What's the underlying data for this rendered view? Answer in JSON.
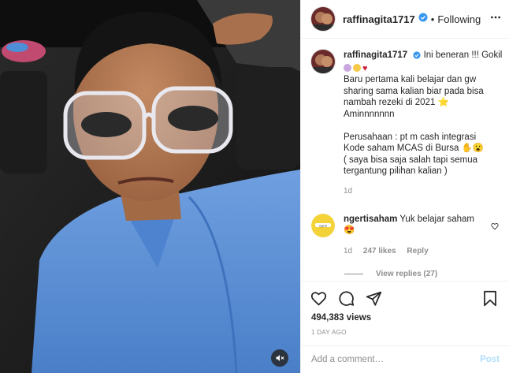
{
  "post": {
    "username": "raffinagita1717",
    "dot": "•",
    "follow_state": "Following"
  },
  "caption": {
    "username": "raffinagita1717",
    "first_line": "Ini beneran !!! Gokil",
    "lines": [
      "Baru pertama kali belajar dan gw",
      "sharing sama kalian biar pada bisa",
      "nambah rezeki di 2021 ⭐",
      "Aminnnnnnn"
    ],
    "lines2": [
      "Perusahaan : pt m cash integrasi",
      "Kode saham MCAS di Bursa ✋😮",
      "( saya bisa saja salah tapi semua",
      "tergantung pilihan kalian )"
    ],
    "time": "1d"
  },
  "comment": {
    "username": "ngertisaham",
    "text": "Yuk belajar saham",
    "emoji_line": "😍",
    "time": "1d",
    "likes": "247 likes",
    "reply_label": "Reply",
    "view_replies": "View replies (27)"
  },
  "stats": {
    "views": "494,383 views",
    "time_ago": "1 DAY AGO"
  },
  "add_comment": {
    "placeholder": "Add a comment…",
    "post_label": "Post"
  },
  "icons": {
    "verified": "verified-badge-icon",
    "more": "more-options-icon",
    "heart": "heart-icon",
    "comment": "comment-icon",
    "share": "share-icon",
    "save": "bookmark-icon",
    "mute": "audio-muted-icon"
  },
  "colors": {
    "verified_blue": "#3897f0",
    "muted_text": "#8e8e8e",
    "post_button_disabled": "#b2dffc",
    "shirt_blue": "#5b8fd6"
  }
}
